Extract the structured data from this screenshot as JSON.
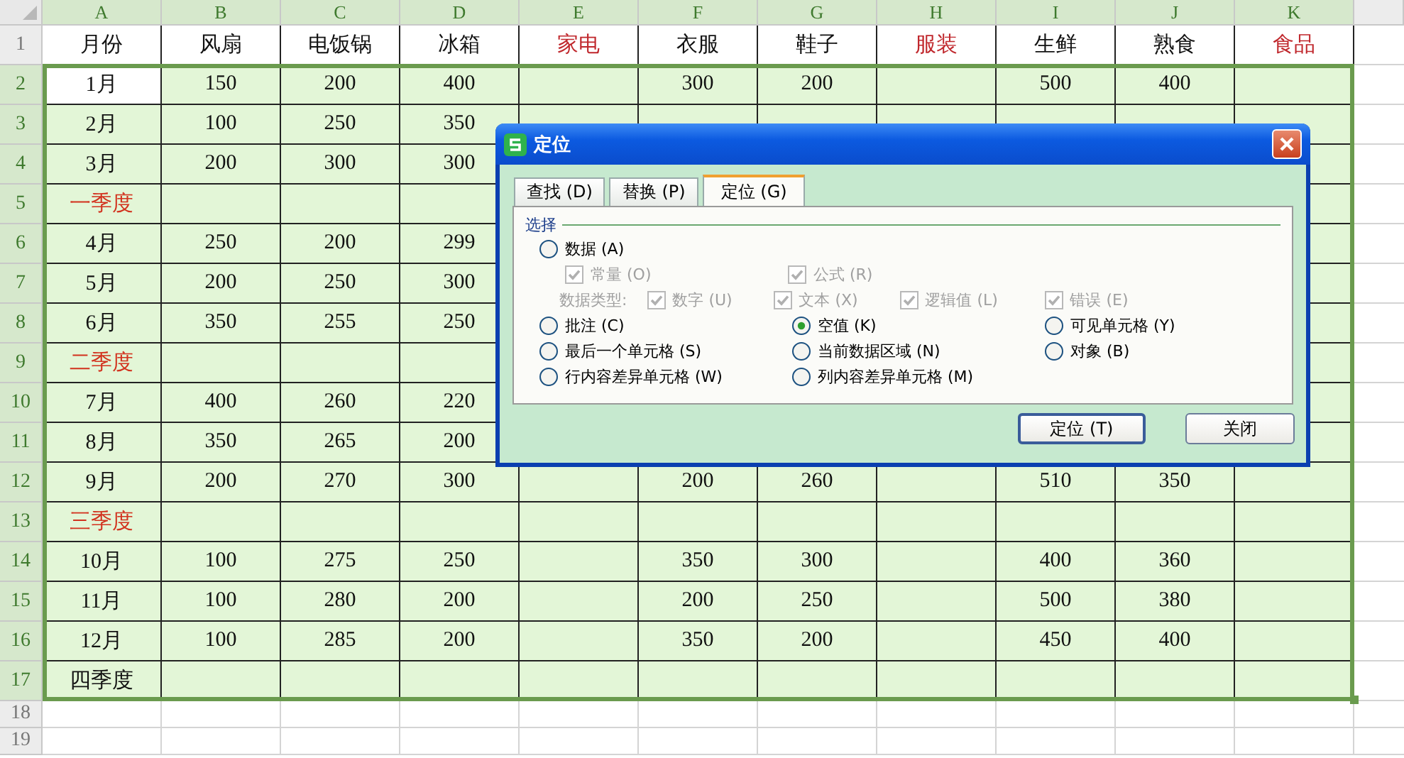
{
  "columns": [
    {
      "label": "A",
      "selected": true
    },
    {
      "label": "B",
      "selected": true
    },
    {
      "label": "C",
      "selected": true
    },
    {
      "label": "D",
      "selected": true
    },
    {
      "label": "E",
      "selected": true
    },
    {
      "label": "F",
      "selected": true
    },
    {
      "label": "G",
      "selected": true
    },
    {
      "label": "H",
      "selected": true
    },
    {
      "label": "I",
      "selected": true
    },
    {
      "label": "J",
      "selected": true
    },
    {
      "label": "K",
      "selected": true
    }
  ],
  "rows": [
    {
      "num": "1",
      "selected": false,
      "cells": [
        "月份",
        "风扇",
        "电饭锅",
        "冰箱",
        {
          "text": "家电",
          "color": "#c0282d"
        },
        "衣服",
        "鞋子",
        {
          "text": "服装",
          "color": "#c0282d"
        },
        "生鲜",
        "熟食",
        {
          "text": "食品",
          "color": "#c0282d"
        }
      ]
    },
    {
      "num": "2",
      "selected": true,
      "cells": [
        {
          "text": "1月",
          "active": true
        },
        "150",
        "200",
        "400",
        null,
        "300",
        "200",
        null,
        "500",
        "400",
        null
      ]
    },
    {
      "num": "3",
      "selected": true,
      "cells": [
        "2月",
        "100",
        "250",
        "350"
      ]
    },
    {
      "num": "4",
      "selected": true,
      "cells": [
        "3月",
        "200",
        "300",
        "300"
      ]
    },
    {
      "num": "5",
      "selected": true,
      "cells": [
        {
          "text": "一季度",
          "color": "#d2321e"
        }
      ]
    },
    {
      "num": "6",
      "selected": true,
      "cells": [
        "4月",
        "250",
        "200",
        "299"
      ]
    },
    {
      "num": "7",
      "selected": true,
      "cells": [
        "5月",
        "200",
        "250",
        "300"
      ]
    },
    {
      "num": "8",
      "selected": true,
      "cells": [
        "6月",
        "350",
        "255",
        "250"
      ]
    },
    {
      "num": "9",
      "selected": true,
      "cells": [
        {
          "text": "二季度",
          "color": "#d2321e"
        }
      ]
    },
    {
      "num": "10",
      "selected": true,
      "cells": [
        "7月",
        "400",
        "260",
        "220"
      ]
    },
    {
      "num": "11",
      "selected": true,
      "cells": [
        "8月",
        "350",
        "265",
        "200"
      ]
    },
    {
      "num": "12",
      "selected": true,
      "cells": [
        "9月",
        "200",
        "270",
        "300",
        null,
        "200",
        "260",
        null,
        "510",
        "350",
        null
      ]
    },
    {
      "num": "13",
      "selected": true,
      "cells": [
        {
          "text": "三季度",
          "color": "#d2321e"
        }
      ]
    },
    {
      "num": "14",
      "selected": true,
      "cells": [
        "10月",
        "100",
        "275",
        "250",
        null,
        "350",
        "300",
        null,
        "400",
        "360",
        null
      ]
    },
    {
      "num": "15",
      "selected": true,
      "cells": [
        "11月",
        "100",
        "280",
        "200",
        null,
        "200",
        "250",
        null,
        "500",
        "380",
        null
      ]
    },
    {
      "num": "16",
      "selected": true,
      "cells": [
        "12月",
        "100",
        "285",
        "200",
        null,
        "350",
        "200",
        null,
        "450",
        "400",
        null
      ]
    },
    {
      "num": "17",
      "selected": true,
      "cells": [
        "四季度"
      ]
    },
    {
      "num": "18",
      "selected": false,
      "cells": []
    },
    {
      "num": "19",
      "selected": false,
      "cells": []
    }
  ],
  "dialog": {
    "title": "定位",
    "tabs": [
      {
        "label": "查找 (D)",
        "selected": false
      },
      {
        "label": "替换 (P)",
        "selected": false
      },
      {
        "label": "定位 (G)",
        "selected": true
      }
    ],
    "group": "选择",
    "data_option": {
      "label": "数据 (A)",
      "selected": false
    },
    "data_subs": [
      {
        "label": "常量 (O)",
        "checked": true,
        "disabled": true
      },
      {
        "label": "公式 (R)",
        "checked": true,
        "disabled": true
      }
    ],
    "data_type_label": "数据类型:",
    "data_types": [
      {
        "label": "数字 (U)",
        "checked": true,
        "disabled": true
      },
      {
        "label": "文本 (X)",
        "checked": true,
        "disabled": true
      },
      {
        "label": "逻辑值 (L)",
        "checked": true,
        "disabled": true
      },
      {
        "label": "错误 (E)",
        "checked": true,
        "disabled": true
      }
    ],
    "options": [
      {
        "label": "批注 (C)",
        "selected": false
      },
      {
        "label": "空值 (K)",
        "selected": true
      },
      {
        "label": "可见单元格 (Y)",
        "selected": false
      },
      {
        "label": "最后一个单元格 (S)",
        "selected": false
      },
      {
        "label": "当前数据区域 (N)",
        "selected": false
      },
      {
        "label": "对象 (B)",
        "selected": false
      },
      {
        "label": "行内容差异单元格 (W)",
        "selected": false
      },
      {
        "label": "列内容差异单元格 (M)",
        "selected": false
      }
    ],
    "buttons": [
      {
        "label": "定位 (T)",
        "default": true
      },
      {
        "label": "关闭",
        "default": false
      }
    ]
  }
}
